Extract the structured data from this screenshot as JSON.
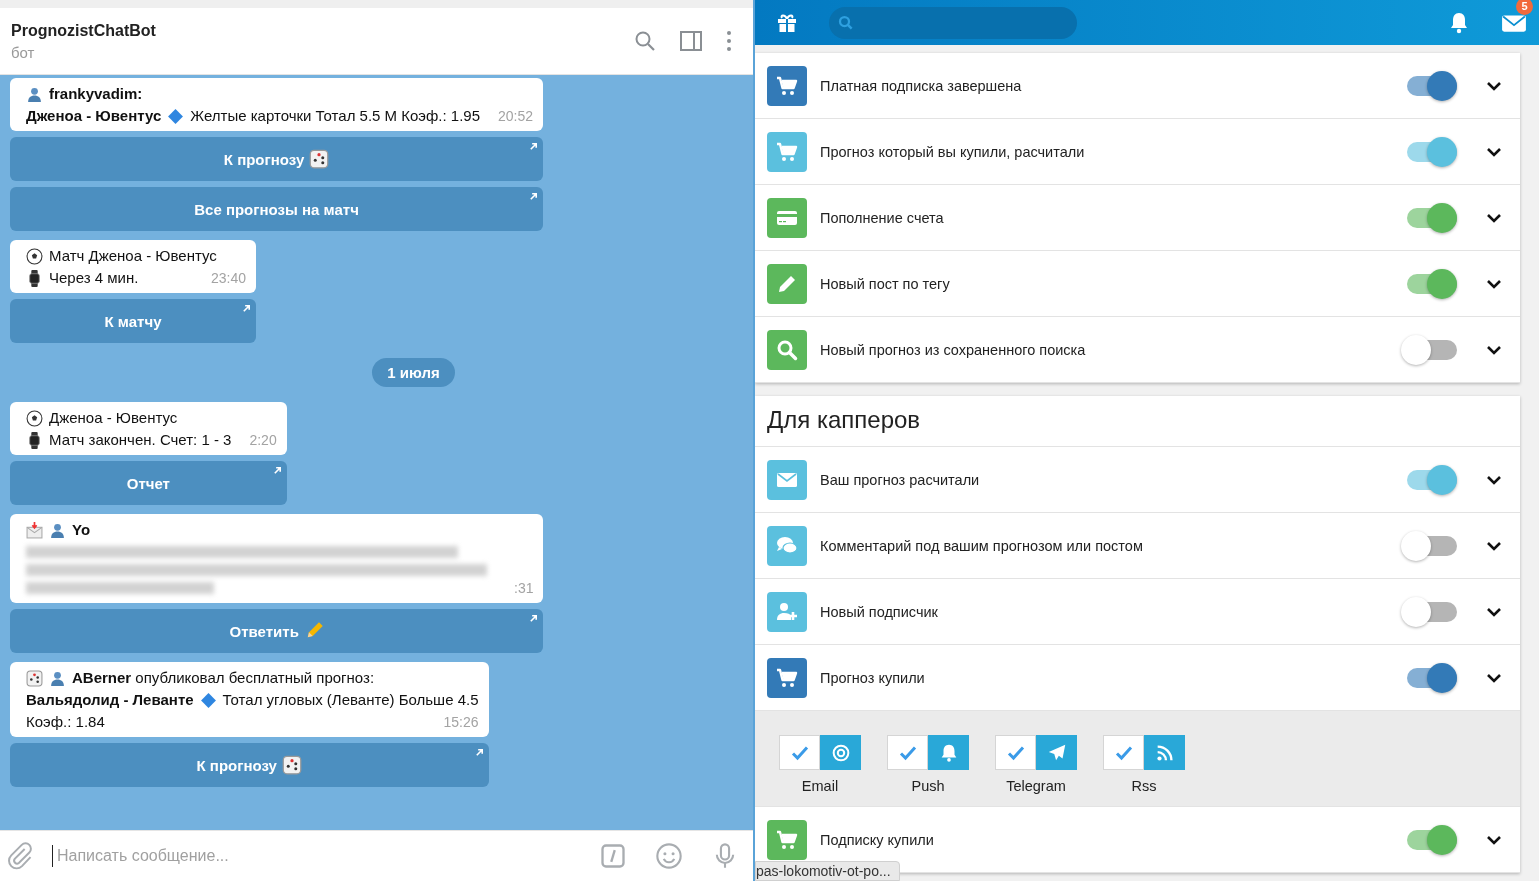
{
  "chat": {
    "title": "PrognozistChatBot",
    "subtitle": "бот",
    "placeholder": "Написать сообщение...",
    "items": [
      {
        "kind": "message",
        "time": "20:52",
        "lines": [
          [
            {
              "kind": "emoji"
            },
            {
              "kind": "text",
              "text": "frankyvadim:",
              "bold": true
            }
          ],
          [
            {
              "kind": "text",
              "text": "Дженоа - Ювентус",
              "bold": true
            },
            {
              "kind": "emoji"
            },
            {
              "kind": "text",
              "text": "Желтые карточки Тотал 5.5 М Коэф.: 1.95"
            }
          ]
        ],
        "buttons": [
          {
            "label": "К прогнозу"
          },
          {
            "label": "Все прогнозы на матч"
          }
        ]
      },
      {
        "kind": "message",
        "time": "23:40",
        "lines": [
          [
            {
              "kind": "emoji"
            },
            {
              "kind": "text",
              "text": "Матч Дженоа - Ювентус"
            }
          ],
          [
            {
              "kind": "emoji"
            },
            {
              "kind": "text",
              "text": "Через 4 мин."
            }
          ]
        ],
        "buttons": [
          {
            "label": "К матчу"
          }
        ]
      },
      {
        "kind": "date",
        "text": "1 июля"
      },
      {
        "kind": "message",
        "time": "2:20",
        "lines": [
          [
            {
              "kind": "emoji"
            },
            {
              "kind": "text",
              "text": "Дженоа - Ювентус"
            }
          ],
          [
            {
              "kind": "emoji"
            },
            {
              "kind": "text",
              "text": "Матч закончен. Счет: 1 - 3"
            }
          ]
        ],
        "buttons": [
          {
            "label": "Отчет"
          }
        ]
      },
      {
        "kind": "message",
        "time": ":31",
        "blurred": true,
        "lines": [
          [
            {
              "kind": "emoji"
            },
            {
              "kind": "emoji"
            },
            {
              "kind": "text",
              "text": "Yo",
              "bold": true
            }
          ]
        ],
        "buttons": [
          {
            "label": "Ответить"
          }
        ]
      },
      {
        "kind": "message",
        "time": "15:26",
        "lines": [
          [
            {
              "kind": "emoji"
            },
            {
              "kind": "emoji"
            },
            {
              "kind": "text",
              "text": "**ABerner** опубликовал бесплатный прогноз:"
            }
          ],
          [
            {
              "kind": "text",
              "text": "Вальядолид - Леванте",
              "bold": true
            },
            {
              "kind": "emoji"
            },
            {
              "kind": "text",
              "text": "Тотал угловых (Леванте) Больше 4.5"
            }
          ],
          [
            {
              "kind": "text",
              "text": "Коэф.: 1.84"
            }
          ]
        ],
        "buttons": [
          {
            "label": "К прогнозу"
          }
        ]
      }
    ]
  },
  "site": {
    "badge": "5",
    "status_link": "pas-lokomotiv-ot-po...",
    "sections": [
      {
        "rows": [
          {
            "label": "Платная подписка завершена",
            "color": "#337ab7",
            "on": true,
            "expanded": false
          },
          {
            "label": "Прогноз который вы купили, расчитали",
            "color": "#5bc0de",
            "on": true,
            "expanded": false
          },
          {
            "label": "Пополнение счета",
            "color": "#5cb85c",
            "on": true,
            "expanded": false
          },
          {
            "label": "Новый пост по тегу",
            "color": "#5cb85c",
            "on": true,
            "expanded": false
          },
          {
            "label": "Новый прогноз из сохраненного поиска",
            "color": "#5cb85c",
            "on": false,
            "expanded": false
          }
        ]
      },
      {
        "title": "Для капперов",
        "rows": [
          {
            "label": "Ваш прогноз расчитали",
            "color": "#5bc0de",
            "on": true,
            "expanded": false
          },
          {
            "label": "Комментарий под вашим прогнозом или постом",
            "color": "#5bc0de",
            "on": false,
            "expanded": false
          },
          {
            "label": "Новый подписчик",
            "color": "#5bc0de",
            "on": false,
            "expanded": false
          },
          {
            "label": "Прогноз купили",
            "color": "#337ab7",
            "on": true,
            "expanded": true,
            "channels": [
              {
                "label": "Email",
                "checked": true
              },
              {
                "label": "Push",
                "checked": true
              },
              {
                "label": "Telegram",
                "checked": true
              },
              {
                "label": "Rss",
                "checked": true
              }
            ]
          },
          {
            "label": "Подписку купили",
            "color": "#5cb85c",
            "on": true,
            "expanded": false
          }
        ]
      }
    ]
  }
}
